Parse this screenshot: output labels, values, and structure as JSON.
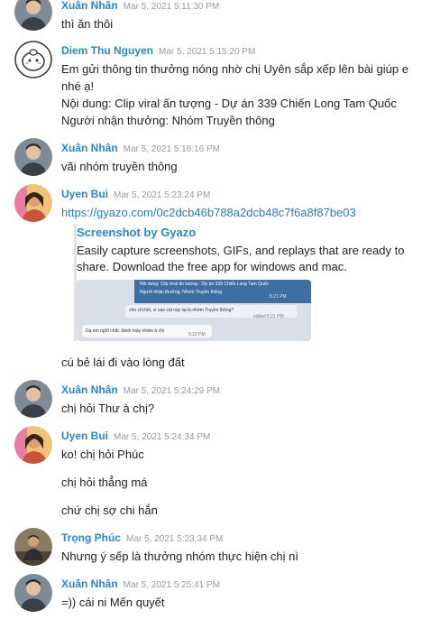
{
  "messages": [
    {
      "name": "Xuân Nhân",
      "time": "Mar 5, 2021 5:11:30 PM",
      "lines": [
        "thì ăn thôi"
      ]
    },
    {
      "name": "Diem Thu Nguyen",
      "time": "Mar 5, 2021 5:15:20 PM",
      "lines": [
        "Em gửi thông tin thưởng nóng nhờ chị Uyên sắp xếp lên bài giúp e nhé ạ!",
        "Nội dung: Clip viral ấn tượng - Dự án 339 Chiến Long Tam Quốc",
        "Người nhận thưởng: Nhóm Truyền thông"
      ]
    },
    {
      "name": "Xuân Nhân",
      "time": "Mar 5, 2021 5:16:16 PM",
      "lines": [
        "vãi nhóm truyền thông"
      ]
    },
    {
      "name": "Uyen Bui",
      "time": "Mar 5, 2021 5:23:24 PM",
      "link": "https://gyazo.com/0c2dcb46b788a2dcb48c7f6a8f87be03",
      "preview": {
        "title": "Screenshot by Gyazo",
        "description": "Easily capture screenshots, GIFs, and replays that are ready to share. Download the free app for windows and mac.",
        "image_lines": [
          "Nội dung: Clip viral ấn tượng - Dự án 339 Chiến Long Tam Quốc",
          "Người nhận thưởng: Nhóm Truyền thông",
          "5:21 PM",
          "cho chị hỏi, vì sao cái này lại là nhóm Truyền thông?",
          "edited 5:21 PM",
          "Dạ em nghĩ chắc đánh máy nhầm à chị",
          "5:22 PM"
        ]
      },
      "lines": [
        "cú bẻ lái đi vào lòng đất"
      ]
    },
    {
      "name": "Xuân Nhân",
      "time": "Mar 5, 2021 5:24:29 PM",
      "lines": [
        "chị hỏi Thư à chị?"
      ]
    },
    {
      "name": "Uyen Bui",
      "time": "Mar 5, 2021 5:24:34 PM",
      "lines": [
        "ko! chị hỏi Phúc",
        "chị hỏi thẳng má",
        "chứ chị sợ chi hắn"
      ]
    },
    {
      "name": "Trọng Phúc",
      "time": "Mar 5, 2021 5:23:34 PM",
      "lines": [
        "Nhưng ý sếp là thưởng nhóm thực hiện chị nì"
      ]
    },
    {
      "name": "Xuân Nhân",
      "time": "Mar 5, 2021 5:25:41 PM",
      "lines": [
        "=)) cái ni Mến quyết"
      ]
    }
  ]
}
